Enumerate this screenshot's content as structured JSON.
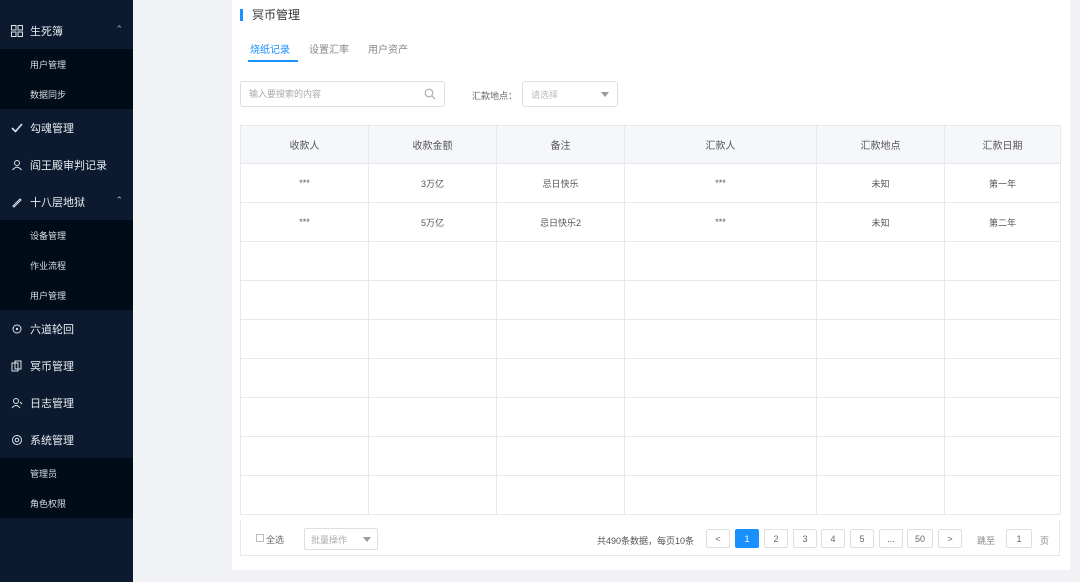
{
  "sidebar": {
    "items": [
      {
        "label": "生死簿",
        "icon": "grid-icon",
        "expanded": true,
        "children": [
          "用户管理",
          "数据同步"
        ]
      },
      {
        "label": "勾魂管理",
        "icon": "check-icon"
      },
      {
        "label": "阎王殿审判记录",
        "icon": "user-icon"
      },
      {
        "label": "十八层地狱",
        "icon": "pen-icon",
        "expanded": true,
        "children": [
          "设备管理",
          "作业流程",
          "用户管理"
        ]
      },
      {
        "label": "六道轮回",
        "icon": "cycle-icon"
      },
      {
        "label": "冥币管理",
        "icon": "layers-icon"
      },
      {
        "label": "日志管理",
        "icon": "person-icon"
      },
      {
        "label": "系统管理",
        "icon": "gear-icon",
        "expanded": true,
        "children": [
          "管理员",
          "角色权限"
        ]
      }
    ]
  },
  "page": {
    "title": "冥币管理",
    "tabs": [
      "烧纸记录",
      "设置汇率",
      "用户资产"
    ]
  },
  "filters": {
    "search_placeholder": "输入要搜索的内容",
    "location_label": "汇款地点：",
    "location_placeholder": "请选择"
  },
  "table": {
    "columns": [
      "收款人",
      "收款金额",
      "备注",
      "汇款人",
      "汇款地点",
      "汇款日期"
    ],
    "rows": [
      [
        "***",
        "3万亿",
        "忌日快乐",
        "***",
        "未知",
        "第一年"
      ],
      [
        "***",
        "5万亿",
        "忌日快乐2",
        "***",
        "未知",
        "第二年"
      ]
    ]
  },
  "footer": {
    "select_all": "全选",
    "batch_placeholder": "批量操作",
    "total_text": "共490条数据，每页10条",
    "prev": "<",
    "next": ">",
    "pages": [
      "1",
      "2",
      "3",
      "4",
      "5",
      "...",
      "50"
    ],
    "current_page": "1",
    "jump_label": "跳至",
    "jump_value": "1",
    "page_unit": "页"
  },
  "colors": {
    "sidebar_bg": "#0b1a2e",
    "submenu_bg": "#000c17",
    "accent": "#1890ff"
  }
}
